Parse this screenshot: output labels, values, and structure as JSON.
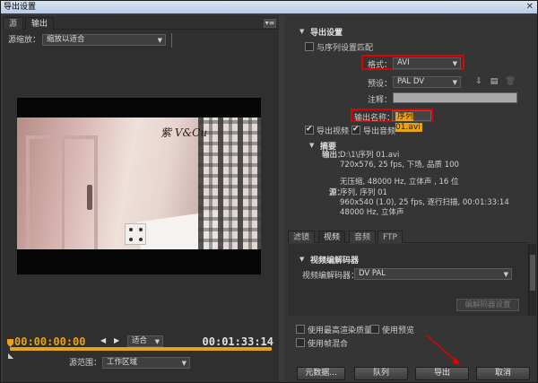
{
  "window": {
    "title": "导出设置"
  },
  "left": {
    "tabs": [
      {
        "label": "源"
      },
      {
        "label": "输出"
      }
    ],
    "scale_label": "源缩放：",
    "scale_value": "缩放以适合",
    "frame_logo": "紫 V&Cu",
    "timecode_current": "00:00:00:00",
    "timecode_end": "00:01:33:14",
    "fit_value": "适合",
    "source_range_label": "源范围：",
    "source_range_value": "工作区域"
  },
  "export": {
    "section_title": "导出设置",
    "match_sequence_label": "与序列设置匹配",
    "match_sequence_checked": false,
    "format_label": "格式：",
    "format_value": "AVI",
    "preset_label": "预设：",
    "preset_value": "PAL DV",
    "notes_label": "注释：",
    "output_name_label": "输出名称：",
    "output_name_value": "序列 01.avi",
    "export_video_label": "导出视频",
    "export_video_checked": true,
    "export_audio_label": "导出音频",
    "export_audio_checked": true,
    "summary_title": "摘要",
    "output_label": "输出：",
    "output_lines": [
      "D:\\1\\序列 01.avi",
      "720x576, 25 fps, 下场, 品质 100",
      "",
      "无压缩, 48000 Hz, 立体声 , 16 位"
    ],
    "source_label": "源：",
    "source_lines": [
      "序列, 序列 01",
      "960x540 (1.0), 25 fps, 逐行扫描, 00:01:33:14",
      "48000 Hz, 立体声"
    ]
  },
  "codec": {
    "tabs": [
      {
        "label": "滤镜"
      },
      {
        "label": "视频"
      },
      {
        "label": "音频"
      },
      {
        "label": "FTP"
      }
    ],
    "section_title": "视频编解码器",
    "codec_label": "视频编解码器：",
    "codec_value": "DV PAL",
    "codec_settings_label": "编解码器设置"
  },
  "options": {
    "max_render_label": "使用最高渲染质量",
    "use_preview_label": "使用预览",
    "frame_blend_label": "使用帧混合"
  },
  "buttons": {
    "metadata": "元数据...",
    "queue": "队列",
    "export": "导出",
    "cancel": "取消"
  },
  "colors": {
    "accent": "#e6a31a",
    "highlight_box": "#e00000"
  }
}
